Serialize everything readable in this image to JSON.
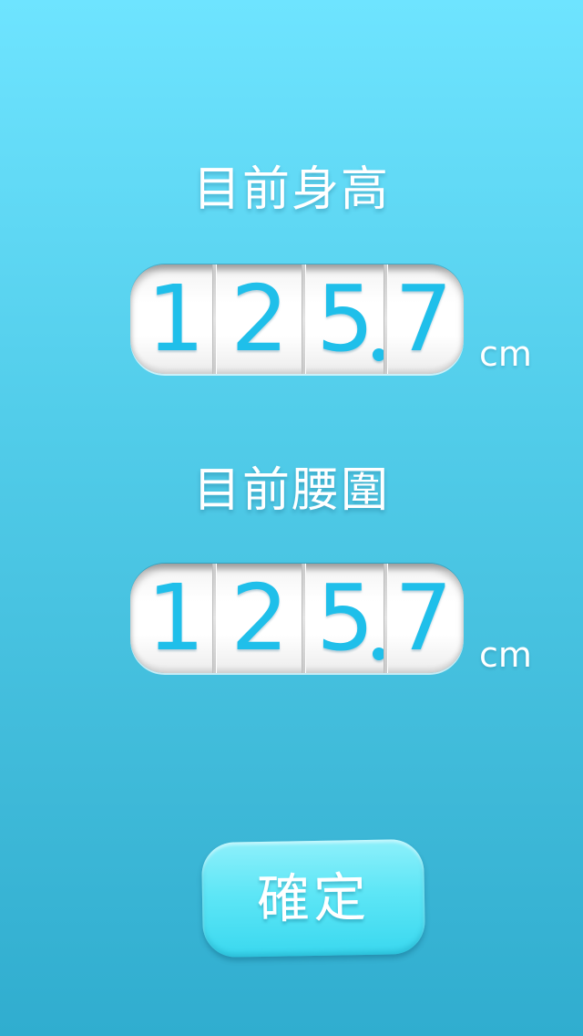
{
  "height_section": {
    "label": "目前身高",
    "digits": [
      "1",
      "2",
      "5",
      "7"
    ],
    "unit": "cm"
  },
  "waist_section": {
    "label": "目前腰圍",
    "digits": [
      "1",
      "2",
      "5",
      "7"
    ],
    "unit": "cm"
  },
  "confirm_button": {
    "label": "確定"
  },
  "colors": {
    "background_top": "#6ee4ff",
    "background_bottom": "#30adcf",
    "digit": "#1fbfea",
    "button": "#5ee6f6"
  }
}
